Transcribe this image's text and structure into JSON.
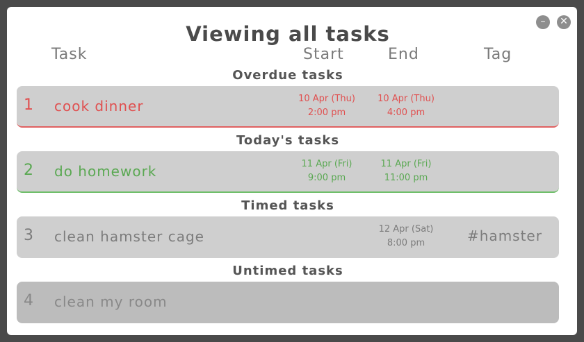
{
  "window": {
    "title": "Viewing all tasks",
    "minimize_icon": "minimize-icon",
    "close_icon": "close-icon"
  },
  "columns": {
    "task": "Task",
    "start": "Start",
    "end": "End",
    "tag": "Tag"
  },
  "sections": {
    "overdue": "Overdue tasks",
    "today": "Today's tasks",
    "timed": "Timed tasks",
    "untimed": "Untimed tasks"
  },
  "tasks": [
    {
      "number": "1",
      "name": "cook dinner",
      "start_date": "10 Apr (Thu)",
      "start_time": "2:00 pm",
      "end_date": "10 Apr (Thu)",
      "end_time": "4:00 pm",
      "tag": "",
      "status_color": "#e05050"
    },
    {
      "number": "2",
      "name": "do homework",
      "start_date": "11 Apr (Fri)",
      "start_time": "9:00 pm",
      "end_date": "11 Apr (Fri)",
      "end_time": "11:00 pm",
      "tag": "",
      "status_color": "#5aa852"
    },
    {
      "number": "3",
      "name": "clean hamster cage",
      "start_date": "",
      "start_time": "",
      "end_date": "12 Apr (Sat)",
      "end_time": "8:00 pm",
      "tag": "#hamster",
      "status_color": "#7c7c7c"
    },
    {
      "number": "4",
      "name": "clean my room",
      "start_date": "",
      "start_time": "",
      "end_date": "",
      "end_time": "",
      "tag": "",
      "status_color": "#888888"
    }
  ]
}
